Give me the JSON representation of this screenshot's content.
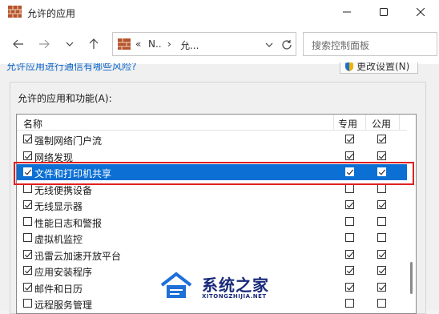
{
  "window": {
    "title": "允许的应用"
  },
  "address": {
    "crumb1": "«",
    "crumb2": "N..",
    "crumb3": "›",
    "crumb4": "允..."
  },
  "search": {
    "placeholder": "搜索控制面板"
  },
  "top": {
    "risk_link": "允许应用进行通信有哪些风险?",
    "change_settings": "更改设置(N)"
  },
  "group": {
    "label": "允许的应用和功能(A):"
  },
  "table": {
    "headers": {
      "name": "名称",
      "private": "专用",
      "public": "公用"
    },
    "rows": [
      {
        "label": "强制网络门户流",
        "enabled": true,
        "private": true,
        "public": true,
        "selected": false
      },
      {
        "label": "网络发现",
        "enabled": true,
        "private": true,
        "public": true,
        "selected": false
      },
      {
        "label": "文件和打印机共享",
        "enabled": true,
        "private": true,
        "public": true,
        "selected": true
      },
      {
        "label": "无线便携设备",
        "enabled": false,
        "private": false,
        "public": false,
        "selected": false
      },
      {
        "label": "无线显示器",
        "enabled": true,
        "private": true,
        "public": true,
        "selected": false
      },
      {
        "label": "性能日志和警报",
        "enabled": false,
        "private": false,
        "public": false,
        "selected": false
      },
      {
        "label": "虚拟机监控",
        "enabled": false,
        "private": false,
        "public": false,
        "selected": false
      },
      {
        "label": "迅雷云加速开放平台",
        "enabled": true,
        "private": true,
        "public": true,
        "selected": false
      },
      {
        "label": "应用安装程序",
        "enabled": true,
        "private": true,
        "public": true,
        "selected": false
      },
      {
        "label": "邮件和日历",
        "enabled": true,
        "private": true,
        "public": true,
        "selected": false
      },
      {
        "label": "远程服务管理",
        "enabled": false,
        "private": false,
        "public": false,
        "selected": false
      }
    ]
  },
  "watermark": {
    "title": "系统之家",
    "subtitle": "XITONGZHIJIA.NET"
  },
  "colors": {
    "selection": "#0b6fd4",
    "highlight": "#e02020",
    "link": "#0a64c8"
  }
}
